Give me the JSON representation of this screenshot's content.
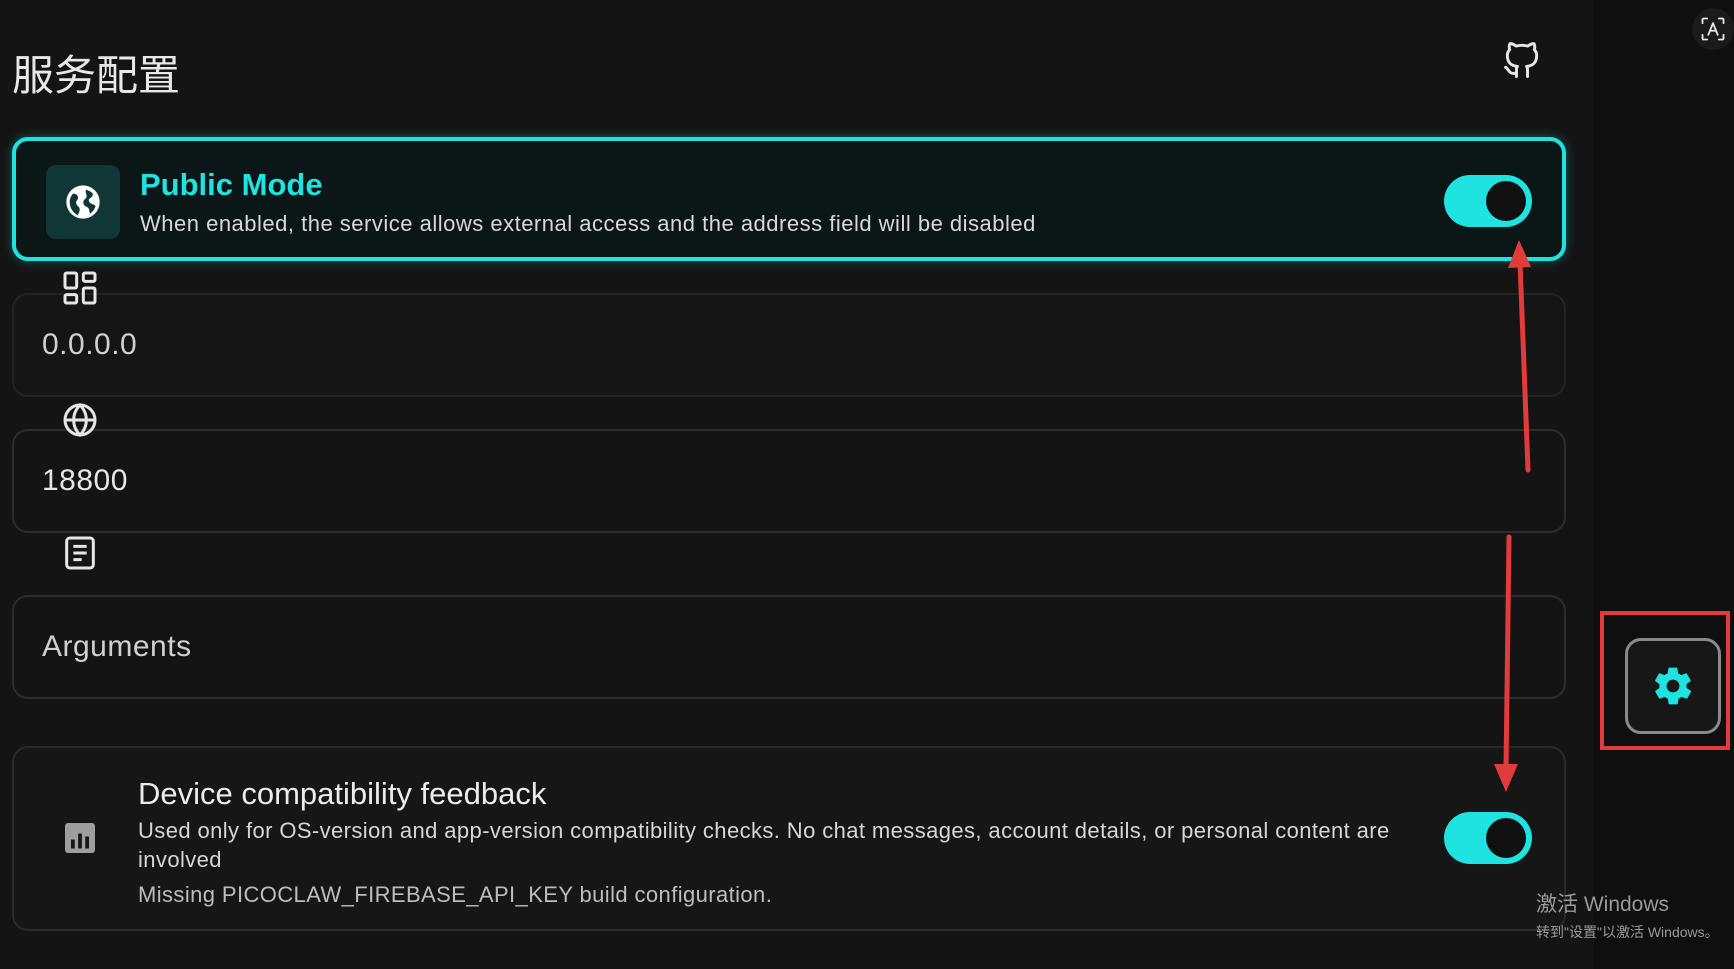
{
  "page": {
    "title": "服务配置"
  },
  "icons": {
    "github": "github-icon",
    "globe": "globe-icon",
    "chart": "bar-chart-icon",
    "dashboard": "dashboard-grid-icon",
    "network": "globe-icon",
    "logs": "document-list-icon",
    "settings": "gear-icon",
    "translate": "translate-icon"
  },
  "public_mode": {
    "title": "Public Mode",
    "description": "When enabled, the service allows external access and the address field will be disabled",
    "enabled": true
  },
  "fields": {
    "address": {
      "placeholder": "0.0.0.0",
      "disabled": true
    },
    "port": {
      "value": "18800"
    },
    "arguments": {
      "placeholder": "Arguments"
    }
  },
  "feedback": {
    "title": "Device compatibility feedback",
    "description": "Used only for OS-version and app-version compatibility checks. No chat messages, account details, or personal content are involved",
    "note": "Missing PICOCLAW_FIREBASE_API_KEY build configuration.",
    "enabled": true
  },
  "watermark": {
    "line1": "激活 Windows",
    "line2": "转到\"设置\"以激活 Windows。"
  },
  "colors": {
    "accent": "#1ee3e0",
    "annotation": "#e23b3b",
    "background": "#141414"
  }
}
